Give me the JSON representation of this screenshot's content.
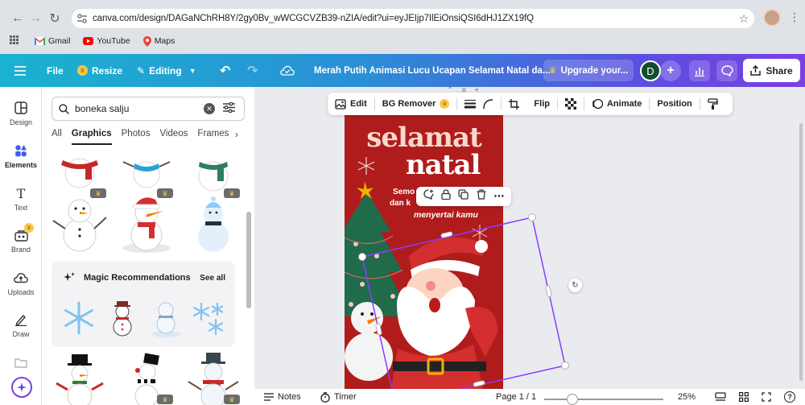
{
  "browser": {
    "url": "canva.com/design/DAGaNChRH8Y/2gy0Bv_wWCGCVZB39-nZIA/edit?ui=eyJEIjp7IlEiOnsiQSI6dHJ1ZX19fQ",
    "bookmarks": [
      {
        "label": "Gmail",
        "icon": "gmail-icon"
      },
      {
        "label": "YouTube",
        "icon": "youtube-icon"
      },
      {
        "label": "Maps",
        "icon": "maps-icon"
      }
    ]
  },
  "header": {
    "file": "File",
    "resize": "Resize",
    "editing": "Editing",
    "title": "Merah Putih Animasi Lucu Ucapan Selamat Natal da...",
    "upgrade": "Upgrade your...",
    "avatar": "D",
    "share": "Share"
  },
  "rail": {
    "items": [
      {
        "label": "Design",
        "icon": "design-icon"
      },
      {
        "label": "Elements",
        "icon": "elements-icon"
      },
      {
        "label": "Text",
        "icon": "text-icon"
      },
      {
        "label": "Brand",
        "icon": "brand-icon"
      },
      {
        "label": "Uploads",
        "icon": "uploads-icon"
      },
      {
        "label": "Draw",
        "icon": "draw-icon"
      }
    ]
  },
  "panel": {
    "search_value": "boneka salju",
    "tabs": [
      {
        "label": "All",
        "active": false
      },
      {
        "label": "Graphics",
        "active": true
      },
      {
        "label": "Photos",
        "active": false
      },
      {
        "label": "Videos",
        "active": false
      },
      {
        "label": "Frames",
        "active": false
      }
    ],
    "magic": {
      "title": "Magic Recommendations",
      "see_all": "See all"
    }
  },
  "toolbar": {
    "edit": "Edit",
    "bg_remover": "BG Remover",
    "flip": "Flip",
    "animate": "Animate",
    "position": "Position"
  },
  "design": {
    "line1": "selamat",
    "line2": "natal",
    "line3": "Semo",
    "line4": "dan k",
    "line5": "menyertai kamu"
  },
  "footer": {
    "notes": "Notes",
    "timer": "Timer",
    "page": "Page 1 / 1",
    "zoom": "25%",
    "zoom_level": 25
  },
  "colors": {
    "brand_gradient_start": "#1ab3cf",
    "brand_gradient_end": "#7b3fe4",
    "selection": "#8b3dff",
    "design_red": "#b01c1c"
  }
}
